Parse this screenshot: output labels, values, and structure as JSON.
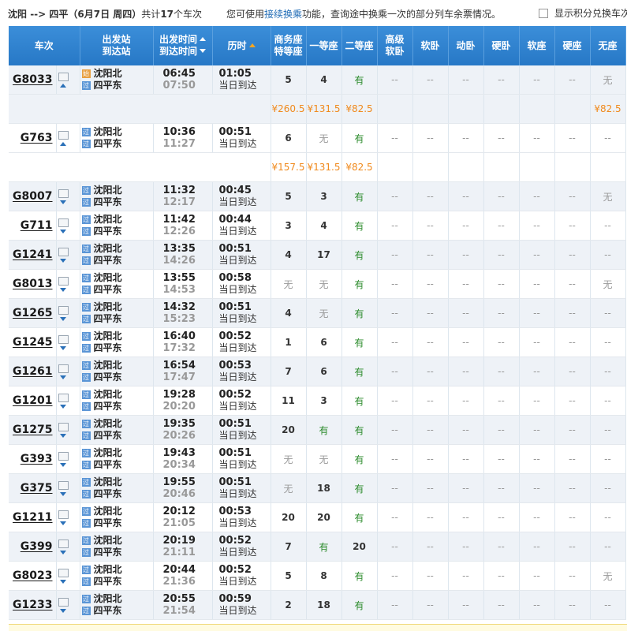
{
  "header": {
    "from": "沈阳",
    "arrow": " --> ",
    "to": "四平",
    "date": "（6月7日 周四）",
    "count_prefix": "共计",
    "count": "17",
    "count_suffix": "个车次",
    "tip_prefix": "您可使用",
    "tip_link": "接续换乘",
    "tip_suffix": "功能，查询途中换乘一次的部分列车余票情况。",
    "points_label": "显示积分兑换车次"
  },
  "columns": {
    "train": "车次",
    "stations_1": "出发站",
    "stations_2": "到达站",
    "times_1": "出发时间",
    "times_2": "到达时间",
    "duration": "历时",
    "business_1": "商务座",
    "business_2": "特等座",
    "first": "一等座",
    "second": "二等座",
    "senior_1": "高级",
    "senior_2": "软卧",
    "soft_sleeper": "软卧",
    "moving_sleeper": "动卧",
    "hard_sleeper": "硬卧",
    "soft_seat": "软座",
    "hard_seat": "硬座",
    "no_seat": "无座"
  },
  "station_tags": {
    "start": "始",
    "pass": "过"
  },
  "same_day": "当日到达",
  "trains": [
    {
      "no": "G8033",
      "from": "沈阳北",
      "to": "四平东",
      "dep": "06:45",
      "arr": "07:50",
      "dur": "01:05",
      "start": true,
      "expanded": true,
      "seats": [
        "5",
        "4",
        "有",
        "--",
        "--",
        "--",
        "--",
        "--",
        "--",
        "无"
      ],
      "prices": [
        "¥260.5",
        "¥131.5",
        "¥82.5",
        "",
        "",
        "",
        "",
        "",
        "",
        "¥82.5"
      ]
    },
    {
      "no": "G763",
      "from": "沈阳北",
      "to": "四平东",
      "dep": "10:36",
      "arr": "11:27",
      "dur": "00:51",
      "start": false,
      "expanded": true,
      "seats": [
        "6",
        "无",
        "有",
        "--",
        "--",
        "--",
        "--",
        "--",
        "--",
        "--"
      ],
      "prices": [
        "¥157.5",
        "¥131.5",
        "¥82.5",
        "",
        "",
        "",
        "",
        "",
        "",
        ""
      ]
    },
    {
      "no": "G8007",
      "from": "沈阳北",
      "to": "四平东",
      "dep": "11:32",
      "arr": "12:17",
      "dur": "00:45",
      "start": false,
      "expanded": false,
      "seats": [
        "5",
        "3",
        "有",
        "--",
        "--",
        "--",
        "--",
        "--",
        "--",
        "无"
      ]
    },
    {
      "no": "G711",
      "from": "沈阳北",
      "to": "四平东",
      "dep": "11:42",
      "arr": "12:26",
      "dur": "00:44",
      "start": false,
      "expanded": false,
      "seats": [
        "3",
        "4",
        "有",
        "--",
        "--",
        "--",
        "--",
        "--",
        "--",
        "--"
      ]
    },
    {
      "no": "G1241",
      "from": "沈阳北",
      "to": "四平东",
      "dep": "13:35",
      "arr": "14:26",
      "dur": "00:51",
      "start": false,
      "expanded": false,
      "seats": [
        "4",
        "17",
        "有",
        "--",
        "--",
        "--",
        "--",
        "--",
        "--",
        "--"
      ]
    },
    {
      "no": "G8013",
      "from": "沈阳北",
      "to": "四平东",
      "dep": "13:55",
      "arr": "14:53",
      "dur": "00:58",
      "start": false,
      "expanded": false,
      "seats": [
        "无",
        "无",
        "有",
        "--",
        "--",
        "--",
        "--",
        "--",
        "--",
        "无"
      ]
    },
    {
      "no": "G1265",
      "from": "沈阳北",
      "to": "四平东",
      "dep": "14:32",
      "arr": "15:23",
      "dur": "00:51",
      "start": false,
      "expanded": false,
      "seats": [
        "4",
        "无",
        "有",
        "--",
        "--",
        "--",
        "--",
        "--",
        "--",
        "--"
      ]
    },
    {
      "no": "G1245",
      "from": "沈阳北",
      "to": "四平东",
      "dep": "16:40",
      "arr": "17:32",
      "dur": "00:52",
      "start": false,
      "expanded": false,
      "seats": [
        "1",
        "6",
        "有",
        "--",
        "--",
        "--",
        "--",
        "--",
        "--",
        "--"
      ]
    },
    {
      "no": "G1261",
      "from": "沈阳北",
      "to": "四平东",
      "dep": "16:54",
      "arr": "17:47",
      "dur": "00:53",
      "start": false,
      "expanded": false,
      "seats": [
        "7",
        "6",
        "有",
        "--",
        "--",
        "--",
        "--",
        "--",
        "--",
        "--"
      ]
    },
    {
      "no": "G1201",
      "from": "沈阳北",
      "to": "四平东",
      "dep": "19:28",
      "arr": "20:20",
      "dur": "00:52",
      "start": false,
      "expanded": false,
      "seats": [
        "11",
        "3",
        "有",
        "--",
        "--",
        "--",
        "--",
        "--",
        "--",
        "--"
      ]
    },
    {
      "no": "G1275",
      "from": "沈阳北",
      "to": "四平东",
      "dep": "19:35",
      "arr": "20:26",
      "dur": "00:51",
      "start": false,
      "expanded": false,
      "seats": [
        "20",
        "有",
        "有",
        "--",
        "--",
        "--",
        "--",
        "--",
        "--",
        "--"
      ]
    },
    {
      "no": "G393",
      "from": "沈阳北",
      "to": "四平东",
      "dep": "19:43",
      "arr": "20:34",
      "dur": "00:51",
      "start": false,
      "expanded": false,
      "seats": [
        "无",
        "无",
        "有",
        "--",
        "--",
        "--",
        "--",
        "--",
        "--",
        "--"
      ]
    },
    {
      "no": "G375",
      "from": "沈阳北",
      "to": "四平东",
      "dep": "19:55",
      "arr": "20:46",
      "dur": "00:51",
      "start": false,
      "expanded": false,
      "seats": [
        "无",
        "18",
        "有",
        "--",
        "--",
        "--",
        "--",
        "--",
        "--",
        "--"
      ]
    },
    {
      "no": "G1211",
      "from": "沈阳北",
      "to": "四平东",
      "dep": "20:12",
      "arr": "21:05",
      "dur": "00:53",
      "start": false,
      "expanded": false,
      "seats": [
        "20",
        "20",
        "有",
        "--",
        "--",
        "--",
        "--",
        "--",
        "--",
        "--"
      ]
    },
    {
      "no": "G399",
      "from": "沈阳北",
      "to": "四平东",
      "dep": "20:19",
      "arr": "21:11",
      "dur": "00:52",
      "start": false,
      "expanded": false,
      "seats": [
        "7",
        "有",
        "20",
        "--",
        "--",
        "--",
        "--",
        "--",
        "--",
        "--"
      ]
    },
    {
      "no": "G8023",
      "from": "沈阳北",
      "to": "四平东",
      "dep": "20:44",
      "arr": "21:36",
      "dur": "00:52",
      "start": false,
      "expanded": false,
      "seats": [
        "5",
        "8",
        "有",
        "--",
        "--",
        "--",
        "--",
        "--",
        "--",
        "无"
      ]
    },
    {
      "no": "G1233",
      "from": "沈阳北",
      "to": "四平东",
      "dep": "20:55",
      "arr": "21:54",
      "dur": "00:59",
      "start": false,
      "expanded": false,
      "seats": [
        "2",
        "18",
        "有",
        "--",
        "--",
        "--",
        "--",
        "--",
        "--",
        "--"
      ]
    }
  ]
}
